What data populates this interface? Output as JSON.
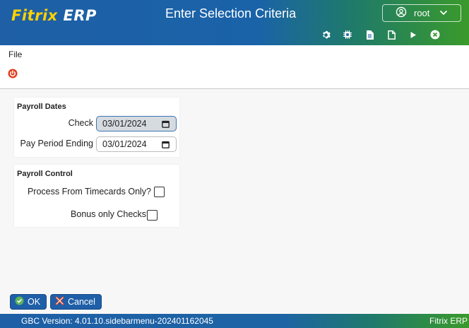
{
  "header": {
    "logo_main": "Fitrix",
    "logo_suffix": "ERP",
    "title": "Enter Selection Criteria",
    "user": {
      "name": "root",
      "icon": "user-circle-icon",
      "dropdown_icon": "chevron-down-icon"
    },
    "toolbar": [
      "gear-icon",
      "chip-icon",
      "document-icon",
      "blank-page-icon",
      "play-icon",
      "close-circle-icon"
    ]
  },
  "menubar": {
    "file_label": "File",
    "power_icon": "power-icon"
  },
  "payroll_dates": {
    "title": "Payroll Dates",
    "check_label": "Check",
    "check_value": "03/01/2024",
    "pay_period_label": "Pay Period Ending",
    "pay_period_value": "03/01/2024"
  },
  "payroll_control": {
    "title": "Payroll Control",
    "timecards_label": "Process From Timecards Only?",
    "timecards_checked": false,
    "bonus_label": "Bonus only Checks?",
    "bonus_checked": false
  },
  "actions": {
    "ok_label": "OK",
    "cancel_label": "Cancel"
  },
  "statusbar": {
    "version_text": "GBC Version: 4.01.10.sidebarmenu-202401162045",
    "app_name": "Fitrix ERP"
  },
  "colors": {
    "brand_blue": "#1e5fa6",
    "brand_green": "#3a9a2a",
    "logo_accent": "#ffd200",
    "power_red": "#e23b1b"
  }
}
